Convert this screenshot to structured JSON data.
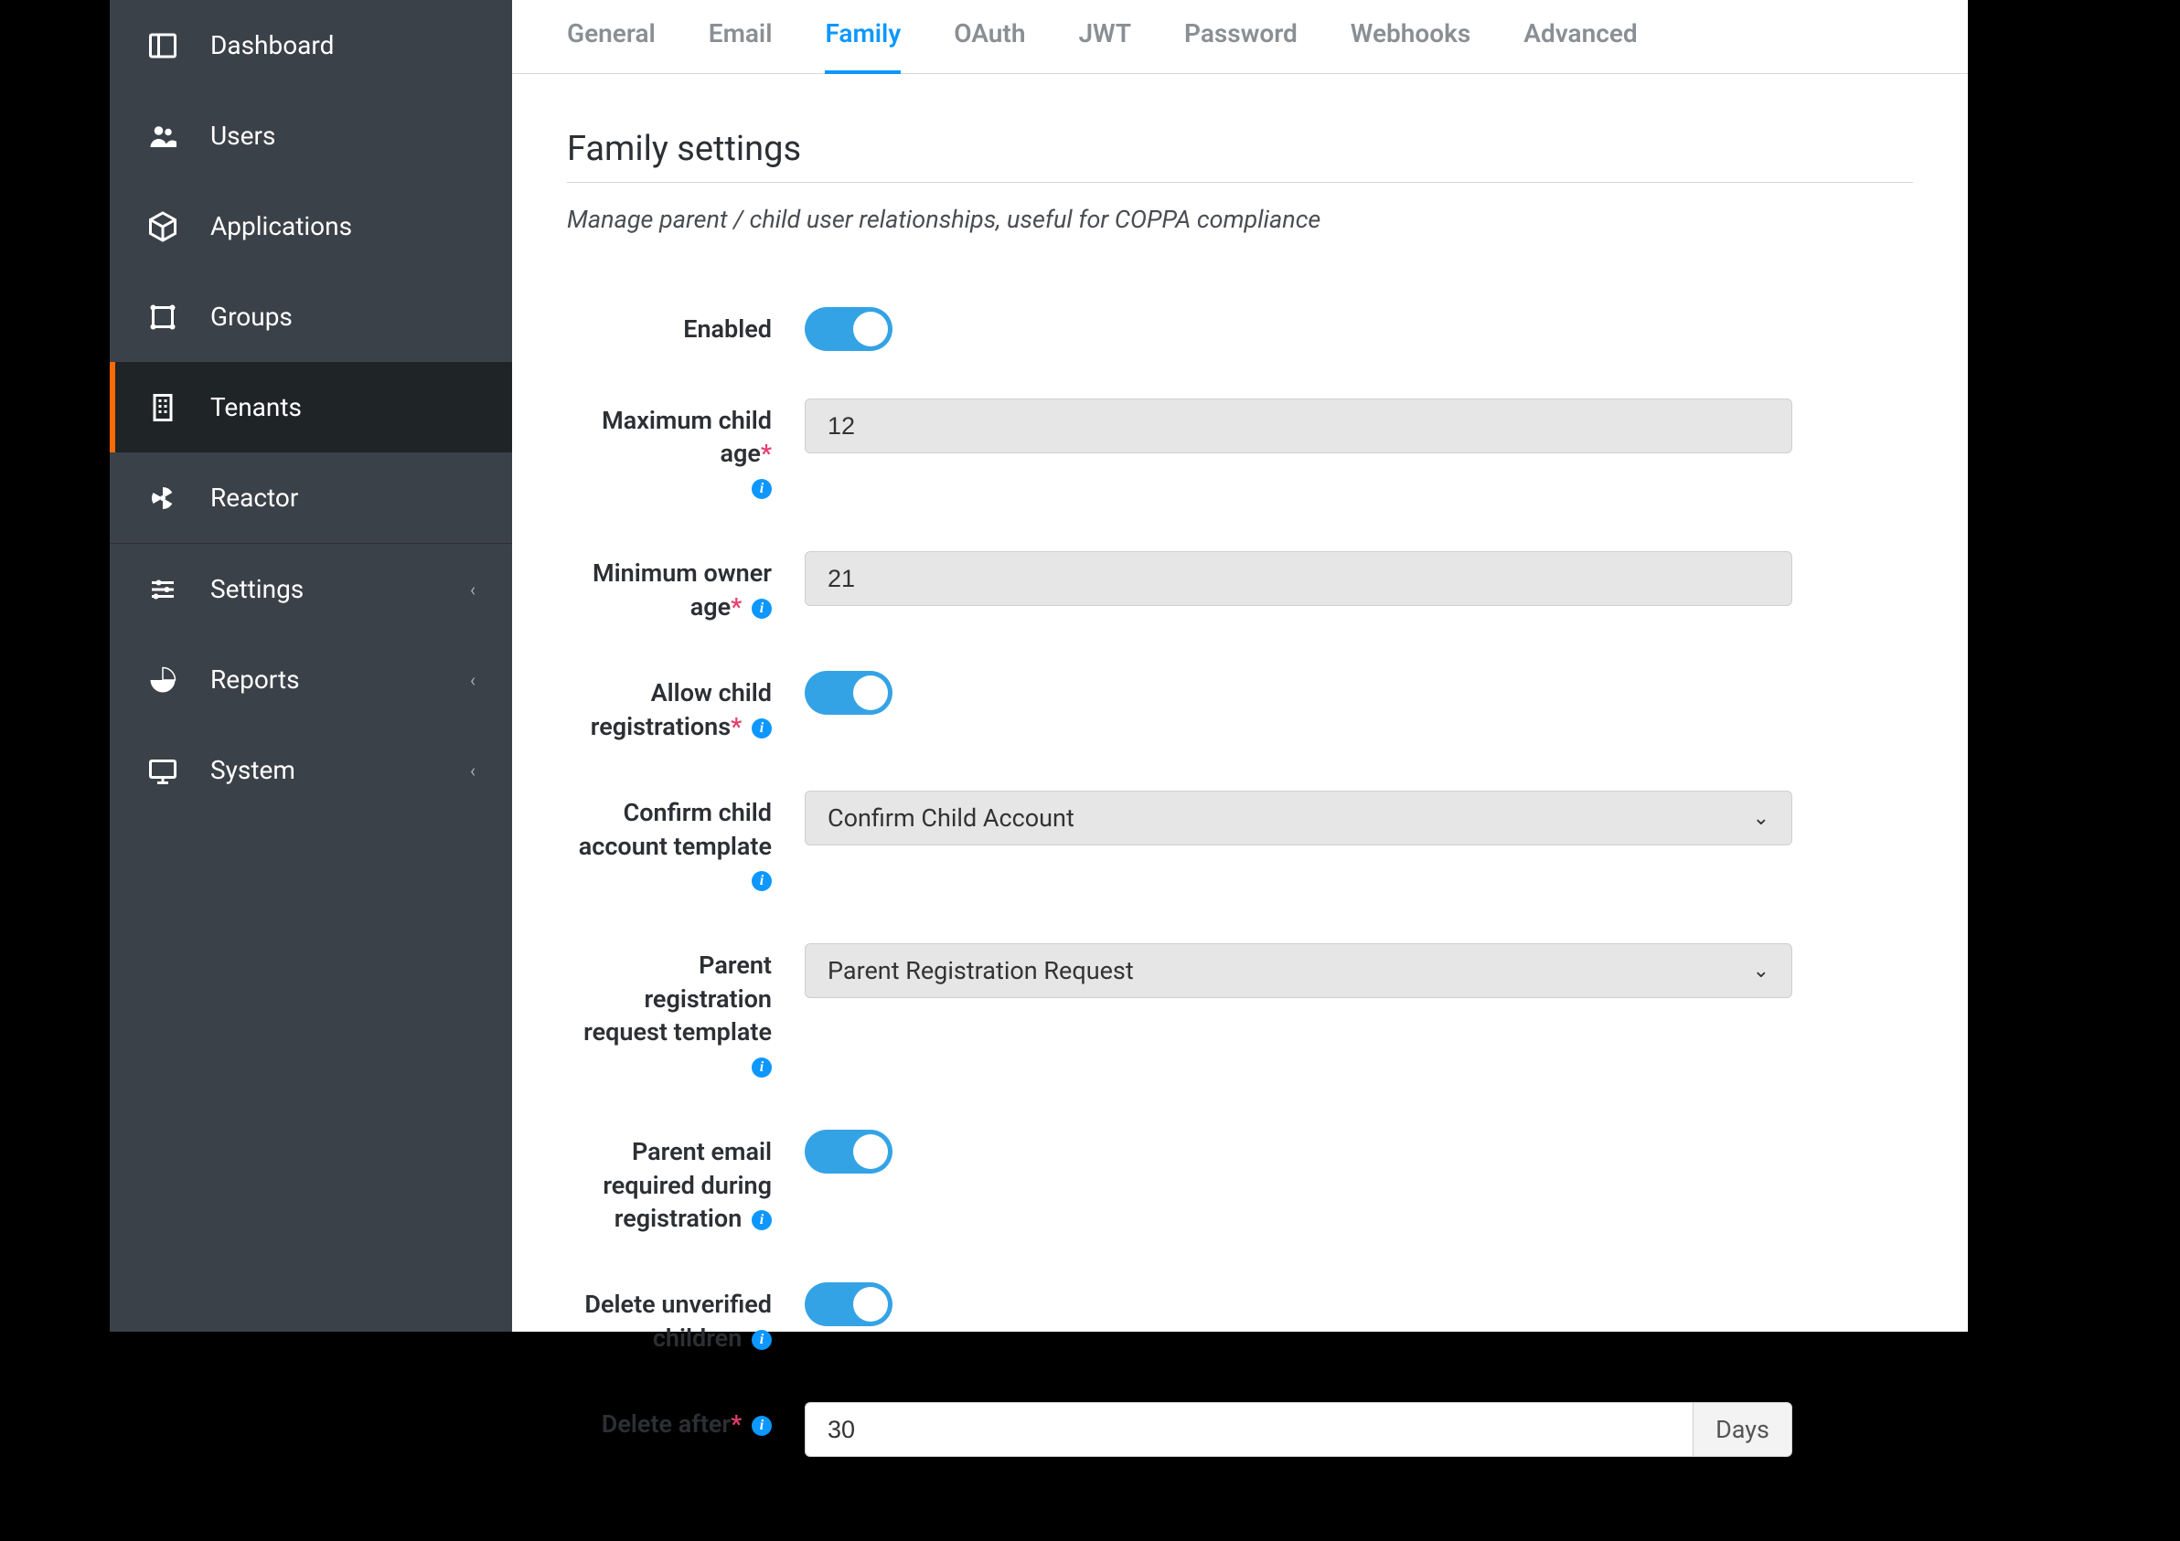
{
  "sidebar": {
    "items": [
      {
        "label": "Dashboard",
        "icon": "dashboard-icon"
      },
      {
        "label": "Users",
        "icon": "users-icon"
      },
      {
        "label": "Applications",
        "icon": "box-icon"
      },
      {
        "label": "Groups",
        "icon": "groups-icon"
      },
      {
        "label": "Tenants",
        "icon": "building-icon",
        "active": true
      },
      {
        "label": "Reactor",
        "icon": "radiation-icon"
      },
      {
        "label": "Settings",
        "icon": "sliders-icon",
        "expandable": true
      },
      {
        "label": "Reports",
        "icon": "piechart-icon",
        "expandable": true
      },
      {
        "label": "System",
        "icon": "monitor-icon",
        "expandable": true
      }
    ]
  },
  "tabs": [
    {
      "label": "General"
    },
    {
      "label": "Email"
    },
    {
      "label": "Family",
      "active": true
    },
    {
      "label": "OAuth"
    },
    {
      "label": "JWT"
    },
    {
      "label": "Password"
    },
    {
      "label": "Webhooks"
    },
    {
      "label": "Advanced"
    }
  ],
  "section": {
    "title": "Family settings",
    "description": "Manage parent / child user relationships, useful for COPPA compliance"
  },
  "form": {
    "enabled": {
      "label": "Enabled",
      "value": true
    },
    "maxChildAge": {
      "label": "Maximum child age",
      "required": true,
      "info": true,
      "value": "12"
    },
    "minOwnerAge": {
      "label": "Minimum owner age",
      "required": true,
      "info": true,
      "value": "21"
    },
    "allowChildReg": {
      "label": "Allow child registrations",
      "required": true,
      "info": true,
      "value": true
    },
    "confirmTemplate": {
      "label": "Confirm child account template",
      "info": true,
      "value": "Confirm Child Account"
    },
    "parentRegTemplate": {
      "label": "Parent registration request template",
      "info": true,
      "value": "Parent Registration Request"
    },
    "parentEmailReq": {
      "label": "Parent email required during registration",
      "info": true,
      "value": true
    },
    "deleteUnverified": {
      "label": "Delete unverified children",
      "info": true,
      "value": true
    },
    "deleteAfter": {
      "label": "Delete after",
      "required": true,
      "info": true,
      "value": "30",
      "unit": "Days"
    }
  }
}
